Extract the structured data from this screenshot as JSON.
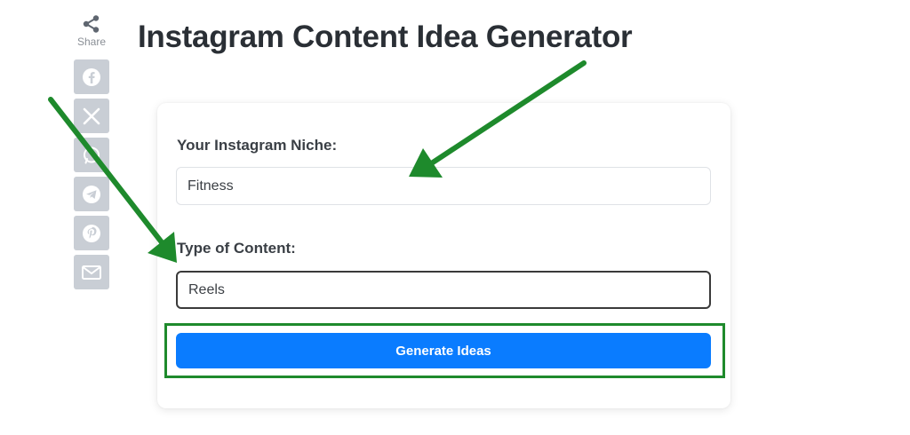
{
  "share": {
    "label": "Share",
    "buttons": [
      {
        "icon": "facebook-icon"
      },
      {
        "icon": "x-icon"
      },
      {
        "icon": "whatsapp-icon"
      },
      {
        "icon": "telegram-icon"
      },
      {
        "icon": "pinterest-icon"
      },
      {
        "icon": "email-icon"
      }
    ],
    "button_color": "#c9ced5"
  },
  "page": {
    "title": "Instagram Content Idea Generator"
  },
  "form": {
    "niche_label": "Your Instagram Niche:",
    "niche_value": "Fitness",
    "type_label": "Type of Content:",
    "type_value": "Reels",
    "generate_label": "Generate Ideas"
  },
  "colors": {
    "accent": "#0a7cff",
    "annotation_green": "#1e8a2c",
    "title": "#2a2f35"
  }
}
